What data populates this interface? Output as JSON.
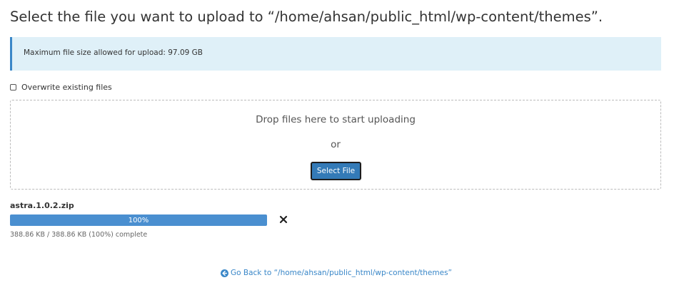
{
  "header": {
    "title": "Select the file you want to upload to “/home/ahsan/public_html/wp-content/themes”."
  },
  "info": {
    "max_size_text": "Maximum file size allowed for upload: 97.09 GB"
  },
  "options": {
    "overwrite_label": "Overwrite existing files",
    "overwrite_checked": false
  },
  "dropzone": {
    "drop_text": "Drop files here to start uploading",
    "or_text": "or",
    "select_button_label": "Select File"
  },
  "upload": {
    "file_name": "astra.1.0.2.zip",
    "progress_percent": 100,
    "progress_label": "100%",
    "status_text": "388.86 KB / 388.86 KB (100%) complete"
  },
  "footer": {
    "go_back_text": "Go Back to “/home/ahsan/public_html/wp-content/themes”"
  },
  "colors": {
    "accent": "#337ab7",
    "info_bg": "#dff0f8",
    "progress": "#4a8fd0",
    "link": "#3a87c8"
  },
  "icons": {
    "cancel": "close-icon",
    "back": "arrow-circle-left-icon"
  }
}
